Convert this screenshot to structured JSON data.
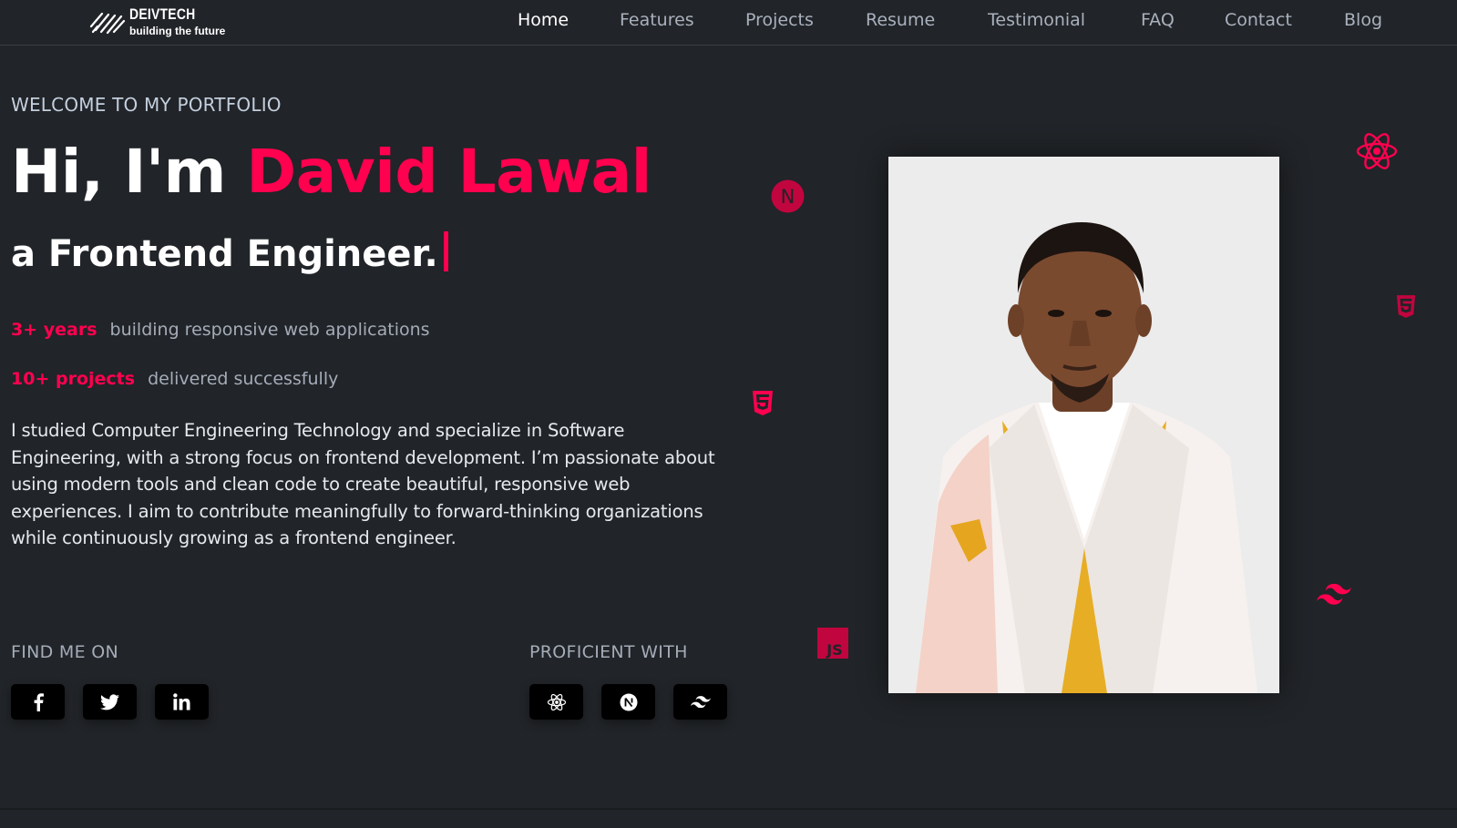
{
  "brand": {
    "name": "DEIVTECH",
    "tagline": "building the future"
  },
  "nav": {
    "items": [
      {
        "label": "Home",
        "active": true
      },
      {
        "label": "Features",
        "active": false
      },
      {
        "label": "Projects",
        "active": false
      },
      {
        "label": "Resume",
        "active": false
      },
      {
        "label": "Testimonial",
        "active": false
      },
      {
        "label": "FAQ",
        "active": false
      },
      {
        "label": "Contact",
        "active": false
      },
      {
        "label": "Blog",
        "active": false
      }
    ]
  },
  "hero": {
    "welcome": "WELCOME TO MY PORTFOLIO",
    "greeting": "Hi, I'm ",
    "name": "David Lawal",
    "role": "a Frontend Engineer.",
    "stats": [
      {
        "highlight": "3+ years",
        "text": "building responsive web applications"
      },
      {
        "highlight": "10+ projects",
        "text": "delivered successfully"
      }
    ],
    "bio": "I studied Computer Engineering Technology and specialize in Software Engineering, with a strong focus on frontend development. I’m passionate about using modern tools and clean code to create beautiful, responsive web experiences. I aim to contribute meaningfully to forward-thinking organizations while continuously growing as a frontend engineer."
  },
  "social": {
    "label": "FIND ME ON",
    "items": [
      {
        "icon": "facebook-icon"
      },
      {
        "icon": "twitter-icon"
      },
      {
        "icon": "linkedin-icon"
      }
    ]
  },
  "skills": {
    "label": "PROFICIENT WITH",
    "items": [
      {
        "icon": "react-icon"
      },
      {
        "icon": "nextjs-icon"
      },
      {
        "icon": "tailwind-icon"
      }
    ]
  },
  "floating_icons": {
    "nextjs_letter": "N",
    "js_label": "JS"
  },
  "colors": {
    "accent": "#ff014f",
    "background": "#212428",
    "text_light": "#ffffff",
    "text_muted": "#a4acb8"
  }
}
